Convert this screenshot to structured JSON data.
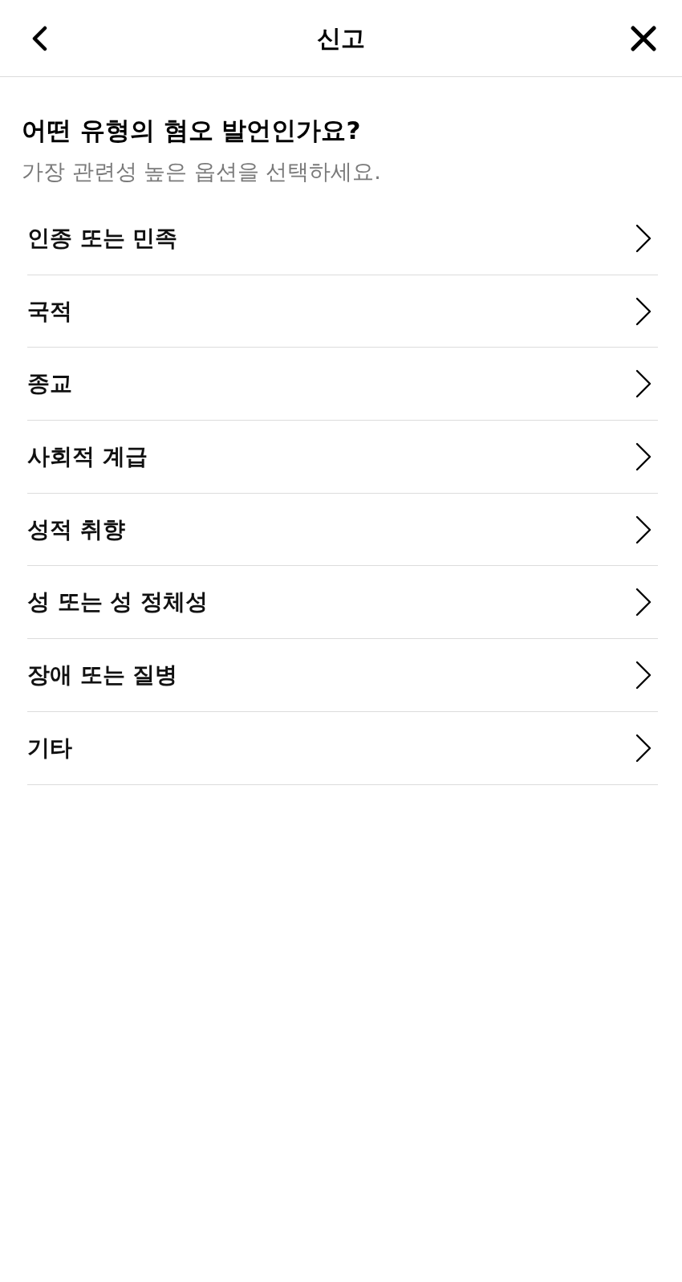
{
  "header": {
    "title": "신고"
  },
  "question": {
    "title": "어떤 유형의 혐오 발언인가요?",
    "subtitle": "가장 관련성 높은 옵션을 선택하세요."
  },
  "options": [
    {
      "label": "인종 또는 민족"
    },
    {
      "label": "국적"
    },
    {
      "label": "종교"
    },
    {
      "label": "사회적 계급"
    },
    {
      "label": "성적 취향"
    },
    {
      "label": "성 또는 성 정체성"
    },
    {
      "label": "장애 또는 질병"
    },
    {
      "label": "기타"
    }
  ]
}
